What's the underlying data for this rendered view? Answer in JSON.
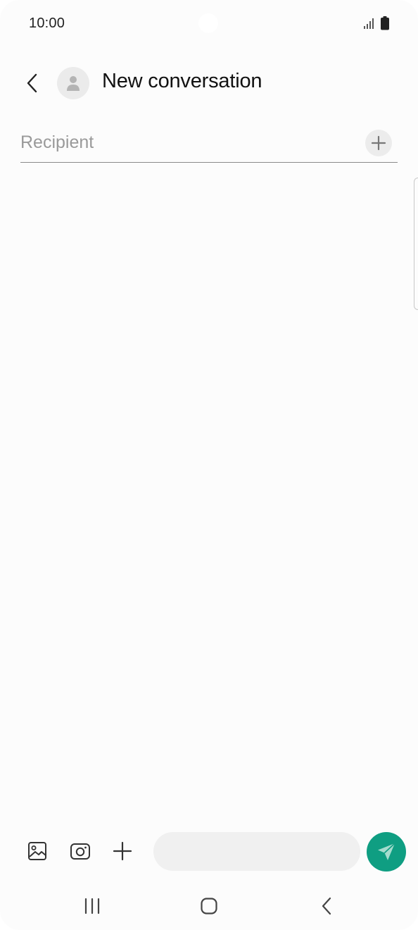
{
  "status_bar": {
    "time": "10:00",
    "signal_icon": "signal-bars-icon",
    "battery_icon": "battery-icon"
  },
  "header": {
    "back_icon": "chevron-left-icon",
    "avatar_icon": "person-icon",
    "title": "New conversation"
  },
  "recipient": {
    "value": "",
    "placeholder": "Recipient",
    "add_icon": "plus-icon"
  },
  "composer": {
    "gallery_icon": "image-icon",
    "camera_icon": "camera-icon",
    "attach_icon": "plus-icon",
    "message_value": "",
    "message_placeholder": "",
    "send_icon": "send-icon"
  },
  "nav_bar": {
    "recents_icon": "recents-icon",
    "home_icon": "home-icon",
    "back_icon": "back-icon"
  },
  "colors": {
    "background": "#fcfcfc",
    "accent": "#0f9e82",
    "input_background": "#f0f0f0",
    "divider": "#8a8a8a"
  }
}
